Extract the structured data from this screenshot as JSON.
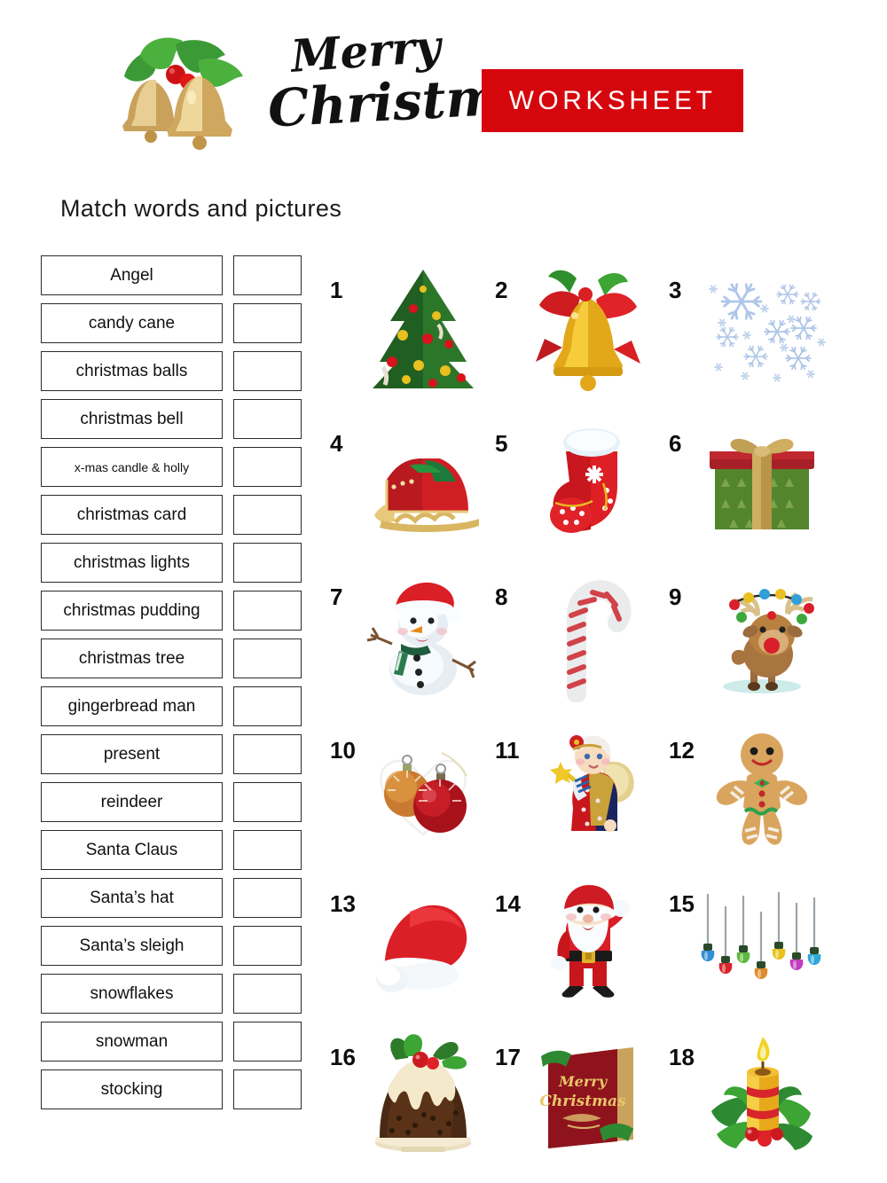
{
  "header": {
    "logo_icon": "christmas-bells-holly-icon",
    "brand_line1": "Merry",
    "brand_line2": "Christmas",
    "banner_label": "WORKSHEET",
    "banner_color": "#D6060D"
  },
  "instruction": "Match words and pictures",
  "word_list": [
    {
      "label": "Angel",
      "size": "normal"
    },
    {
      "label": "candy cane",
      "size": "normal"
    },
    {
      "label": "christmas balls",
      "size": "normal"
    },
    {
      "label": "christmas bell",
      "size": "normal"
    },
    {
      "label": "x-mas candle & holly",
      "size": "small"
    },
    {
      "label": "christmas card",
      "size": "normal"
    },
    {
      "label": "christmas lights",
      "size": "normal"
    },
    {
      "label": "christmas pudding",
      "size": "normal"
    },
    {
      "label": "christmas tree",
      "size": "normal"
    },
    {
      "label": "gingerbread man",
      "size": "normal"
    },
    {
      "label": "present",
      "size": "normal"
    },
    {
      "label": "reindeer",
      "size": "normal"
    },
    {
      "label": "Santa Claus",
      "size": "normal"
    },
    {
      "label": "Santa’s hat",
      "size": "normal"
    },
    {
      "label": "Santa’s sleigh",
      "size": "normal"
    },
    {
      "label": "snowflakes",
      "size": "normal"
    },
    {
      "label": "snowman",
      "size": "normal"
    },
    {
      "label": "stocking",
      "size": "normal"
    }
  ],
  "pictures": [
    {
      "number": "1",
      "icon": "christmas-tree-icon"
    },
    {
      "number": "2",
      "icon": "christmas-bell-icon"
    },
    {
      "number": "3",
      "icon": "snowflakes-icon"
    },
    {
      "number": "4",
      "icon": "santas-sleigh-icon"
    },
    {
      "number": "5",
      "icon": "stocking-icon"
    },
    {
      "number": "6",
      "icon": "present-icon"
    },
    {
      "number": "7",
      "icon": "snowman-icon"
    },
    {
      "number": "8",
      "icon": "candy-cane-icon"
    },
    {
      "number": "9",
      "icon": "reindeer-icon"
    },
    {
      "number": "10",
      "icon": "christmas-balls-icon"
    },
    {
      "number": "11",
      "icon": "angel-icon"
    },
    {
      "number": "12",
      "icon": "gingerbread-man-icon"
    },
    {
      "number": "13",
      "icon": "santas-hat-icon"
    },
    {
      "number": "14",
      "icon": "santa-claus-icon"
    },
    {
      "number": "15",
      "icon": "christmas-lights-icon"
    },
    {
      "number": "16",
      "icon": "christmas-pudding-icon"
    },
    {
      "number": "17",
      "icon": "christmas-card-icon"
    },
    {
      "number": "18",
      "icon": "xmas-candle-holly-icon"
    }
  ],
  "card_art_text": {
    "line1": "Merry",
    "line2": "Christmas"
  },
  "colors": {
    "banner_red": "#D6060D",
    "snowflake_blue": "#AFC6E8",
    "tree_green": "#2E6B2E",
    "gold": "#E0A82E",
    "box_border": "#2b2b2b"
  }
}
